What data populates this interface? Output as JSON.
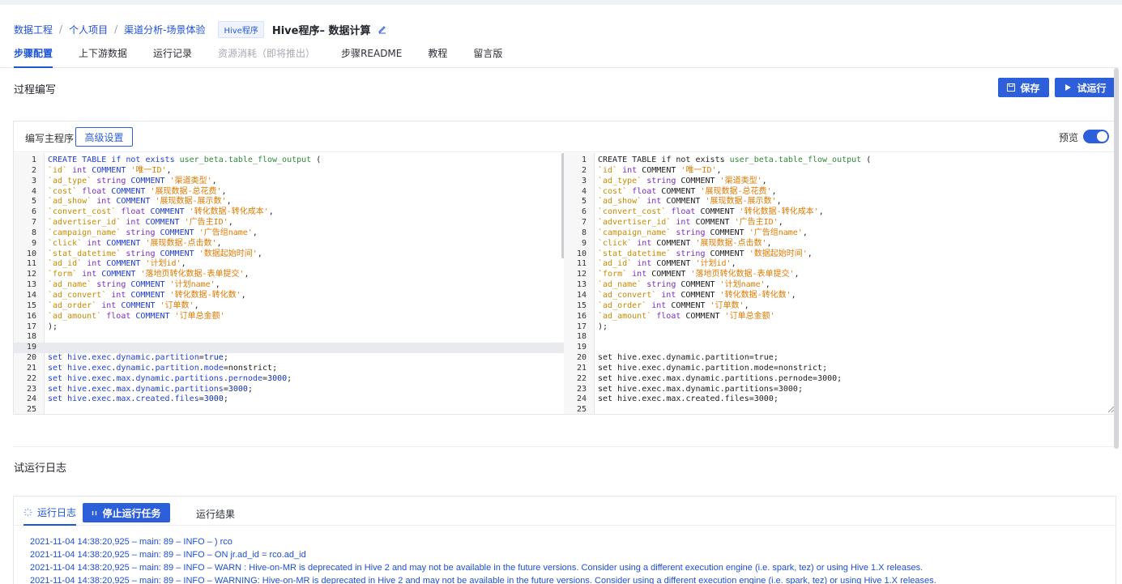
{
  "breadcrumb": {
    "items": [
      "数据工程",
      "个人项目",
      "渠道分析-场景体验"
    ],
    "separator": "/",
    "tag": "Hive程序",
    "title": "Hive程序– 数据计算"
  },
  "tabs": [
    {
      "label": "步骤配置",
      "state": "active"
    },
    {
      "label": "上下游数据",
      "state": "normal"
    },
    {
      "label": "运行记录",
      "state": "normal"
    },
    {
      "label": "资源消耗（即将推出）",
      "state": "disabled"
    },
    {
      "label": "步骤README",
      "state": "normal"
    },
    {
      "label": "教程",
      "state": "normal"
    },
    {
      "label": "留言版",
      "state": "normal"
    }
  ],
  "process": {
    "title": "过程编写",
    "save_label": "保存",
    "run_label": "试运行"
  },
  "editor": {
    "main_label": "编写主程序",
    "advanced_label": "高级设置",
    "preview_label": "预览",
    "preview_on": true,
    "current_line": 19,
    "code": [
      "CREATE TABLE if not exists user_beta.table_flow_output (",
      "`id` int COMMENT '唯一ID',",
      "`ad_type` string COMMENT '渠道类型',",
      "`cost` float COMMENT '展现数据-总花费',",
      "`ad_show` int COMMENT '展现数据-展示数',",
      "`convert_cost` float COMMENT '转化数据-转化成本',",
      "`advertiser_id` int COMMENT '广告主ID',",
      "`campaign_name` string COMMENT '广告组name',",
      "`click` int COMMENT '展现数据-点击数',",
      "`stat_datetime` string COMMENT '数据起始时间',",
      "`ad_id` int COMMENT '计划id',",
      "`form` int COMMENT '落地页转化数据-表单提交',",
      "`ad_name` string COMMENT '计划name',",
      "`ad_convert` int COMMENT '转化数据-转化数',",
      "`ad_order` int COMMENT '订单数',",
      "`ad_amount` float COMMENT '订单总金额'",
      ");",
      "",
      "",
      "set hive.exec.dynamic.partition=true;",
      "set hive.exec.dynamic.partition.mode=nonstrict;",
      "set hive.exec.max.dynamic.partitions.pernode=3000;",
      "set hive.exec.max.dynamic.partitions=3000;",
      "set hive.exec.max.created.files=3000;",
      ""
    ]
  },
  "log_section": {
    "title": "试运行日志",
    "tab_log": "运行日志",
    "stop_label": "停止运行任务",
    "tab_result": "运行结果",
    "lines": [
      "2021-11-04 14:38:20,925 – main: 89 – INFO – ) rco",
      "2021-11-04 14:38:20,925 – main: 89 – INFO – ON jr.ad_id = rco.ad_id",
      "2021-11-04 14:38:20,925 – main: 89 – INFO – WARN  : Hive-on-MR is deprecated in Hive 2 and may not be available in the future versions. Consider using a different execution engine (i.e. spark, tez) or using Hive 1.X releases.",
      "2021-11-04 14:38:20,925 – main: 89 – INFO – WARNING: Hive-on-MR is deprecated in Hive 2 and may not be available in the future versions. Consider using a different execution engine (i.e. spark, tez) or using Hive 1.X releases."
    ]
  },
  "colors": {
    "accent": "#2c5fd9",
    "link": "#1d4ed8",
    "keyword": "#1e3ed3",
    "string": "#e07a00"
  }
}
